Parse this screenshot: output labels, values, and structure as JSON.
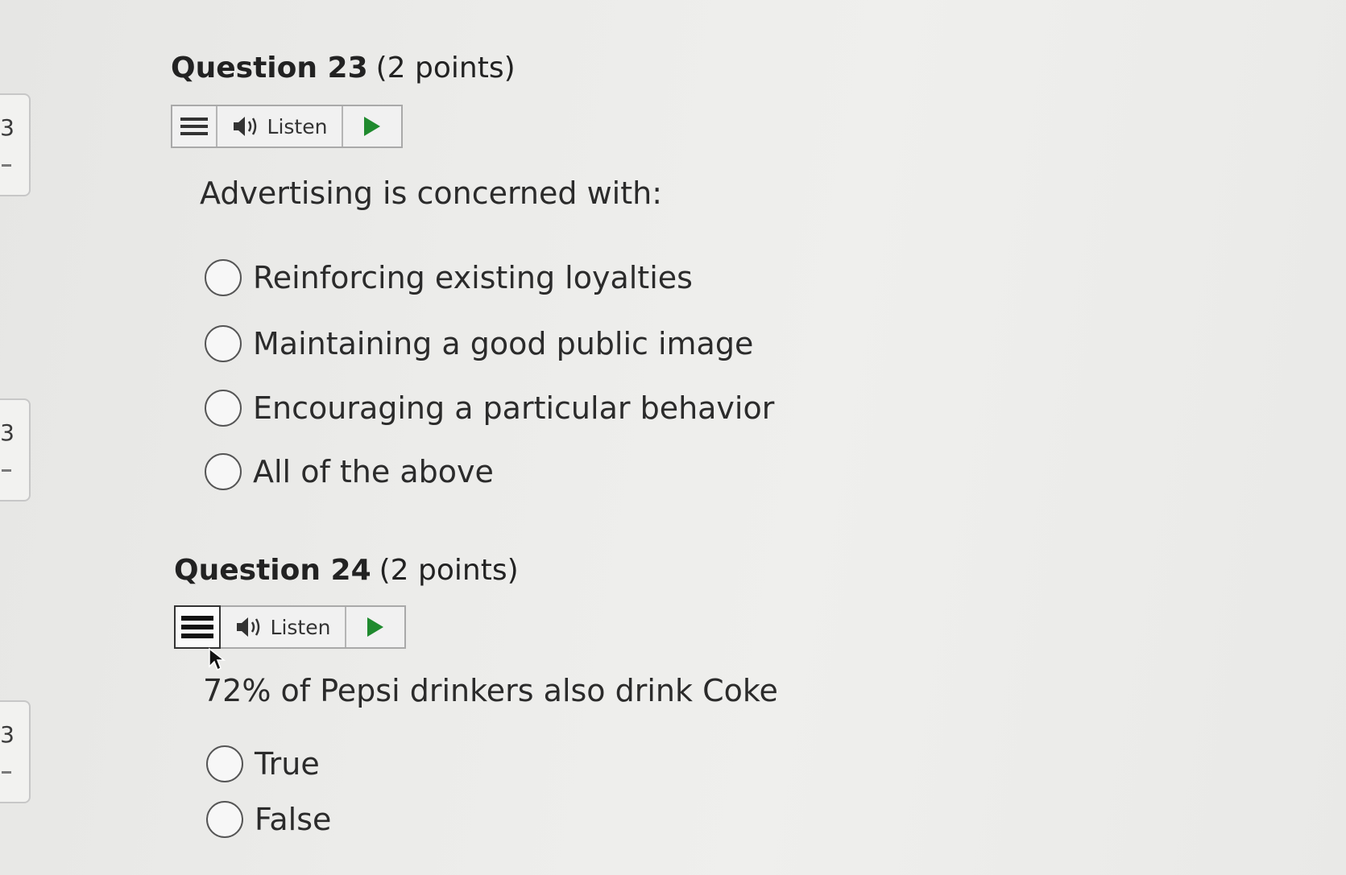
{
  "side_nav": {
    "cards": [
      {
        "number": "3"
      },
      {
        "number": "3"
      },
      {
        "number": "3"
      }
    ]
  },
  "questions": [
    {
      "label": "Question 23",
      "points": "(2 points)",
      "listen_label": "Listen",
      "prompt": "Advertising is concerned with:",
      "options": [
        "Reinforcing existing loyalties",
        "Maintaining a good public image",
        "Encouraging a particular behavior",
        "All of the above"
      ]
    },
    {
      "label": "Question 24",
      "points": "(2 points)",
      "listen_label": "Listen",
      "prompt": "72% of Pepsi drinkers also drink Coke",
      "options": [
        "True",
        "False"
      ]
    }
  ],
  "icons": {
    "menu": "menu-icon",
    "speaker": "speaker-icon",
    "play": "play-icon",
    "cursor": "mouse-pointer-icon"
  },
  "colors": {
    "play_green": "#1f8a2e",
    "text": "#2b2b2b",
    "border": "#a9a9a9"
  }
}
